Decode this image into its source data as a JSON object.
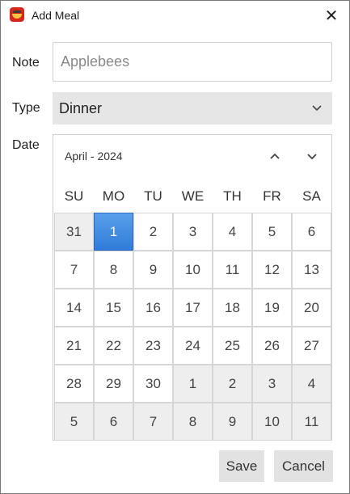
{
  "window": {
    "title": "Add Meal",
    "close_glyph": "✕"
  },
  "form": {
    "note_label": "Note",
    "note_placeholder": "Applebees",
    "note_value": "",
    "type_label": "Type",
    "type_value": "Dinner",
    "date_label": "Date"
  },
  "calendar": {
    "month_label": "April - 2024",
    "weekdays": [
      "SU",
      "MO",
      "TU",
      "WE",
      "TH",
      "FR",
      "SA"
    ],
    "selected_day": "1",
    "weeks": [
      [
        {
          "d": "31",
          "other": true
        },
        {
          "d": "1",
          "sel": true
        },
        {
          "d": "2"
        },
        {
          "d": "3"
        },
        {
          "d": "4"
        },
        {
          "d": "5"
        },
        {
          "d": "6"
        }
      ],
      [
        {
          "d": "7"
        },
        {
          "d": "8"
        },
        {
          "d": "9"
        },
        {
          "d": "10"
        },
        {
          "d": "11"
        },
        {
          "d": "12"
        },
        {
          "d": "13"
        }
      ],
      [
        {
          "d": "14"
        },
        {
          "d": "15"
        },
        {
          "d": "16"
        },
        {
          "d": "17"
        },
        {
          "d": "18"
        },
        {
          "d": "19"
        },
        {
          "d": "20"
        }
      ],
      [
        {
          "d": "21"
        },
        {
          "d": "22"
        },
        {
          "d": "23"
        },
        {
          "d": "24"
        },
        {
          "d": "25"
        },
        {
          "d": "26"
        },
        {
          "d": "27"
        }
      ],
      [
        {
          "d": "28"
        },
        {
          "d": "29"
        },
        {
          "d": "30"
        },
        {
          "d": "1",
          "other": true
        },
        {
          "d": "2",
          "other": true
        },
        {
          "d": "3",
          "other": true
        },
        {
          "d": "4",
          "other": true
        }
      ],
      [
        {
          "d": "5",
          "other": true
        },
        {
          "d": "6",
          "other": true
        },
        {
          "d": "7",
          "other": true
        },
        {
          "d": "8",
          "other": true
        },
        {
          "d": "9",
          "other": true
        },
        {
          "d": "10",
          "other": true
        },
        {
          "d": "11",
          "other": true
        }
      ]
    ]
  },
  "buttons": {
    "save": "Save",
    "cancel": "Cancel"
  },
  "colors": {
    "selected": "#2f7bd8",
    "other_month": "#eeeeee",
    "select_bg": "#e6e6e6"
  },
  "icons": {
    "app": "cooking-pot-icon",
    "close": "close-icon",
    "chevron_up": "chevron-up-icon",
    "chevron_down": "chevron-down-icon"
  }
}
